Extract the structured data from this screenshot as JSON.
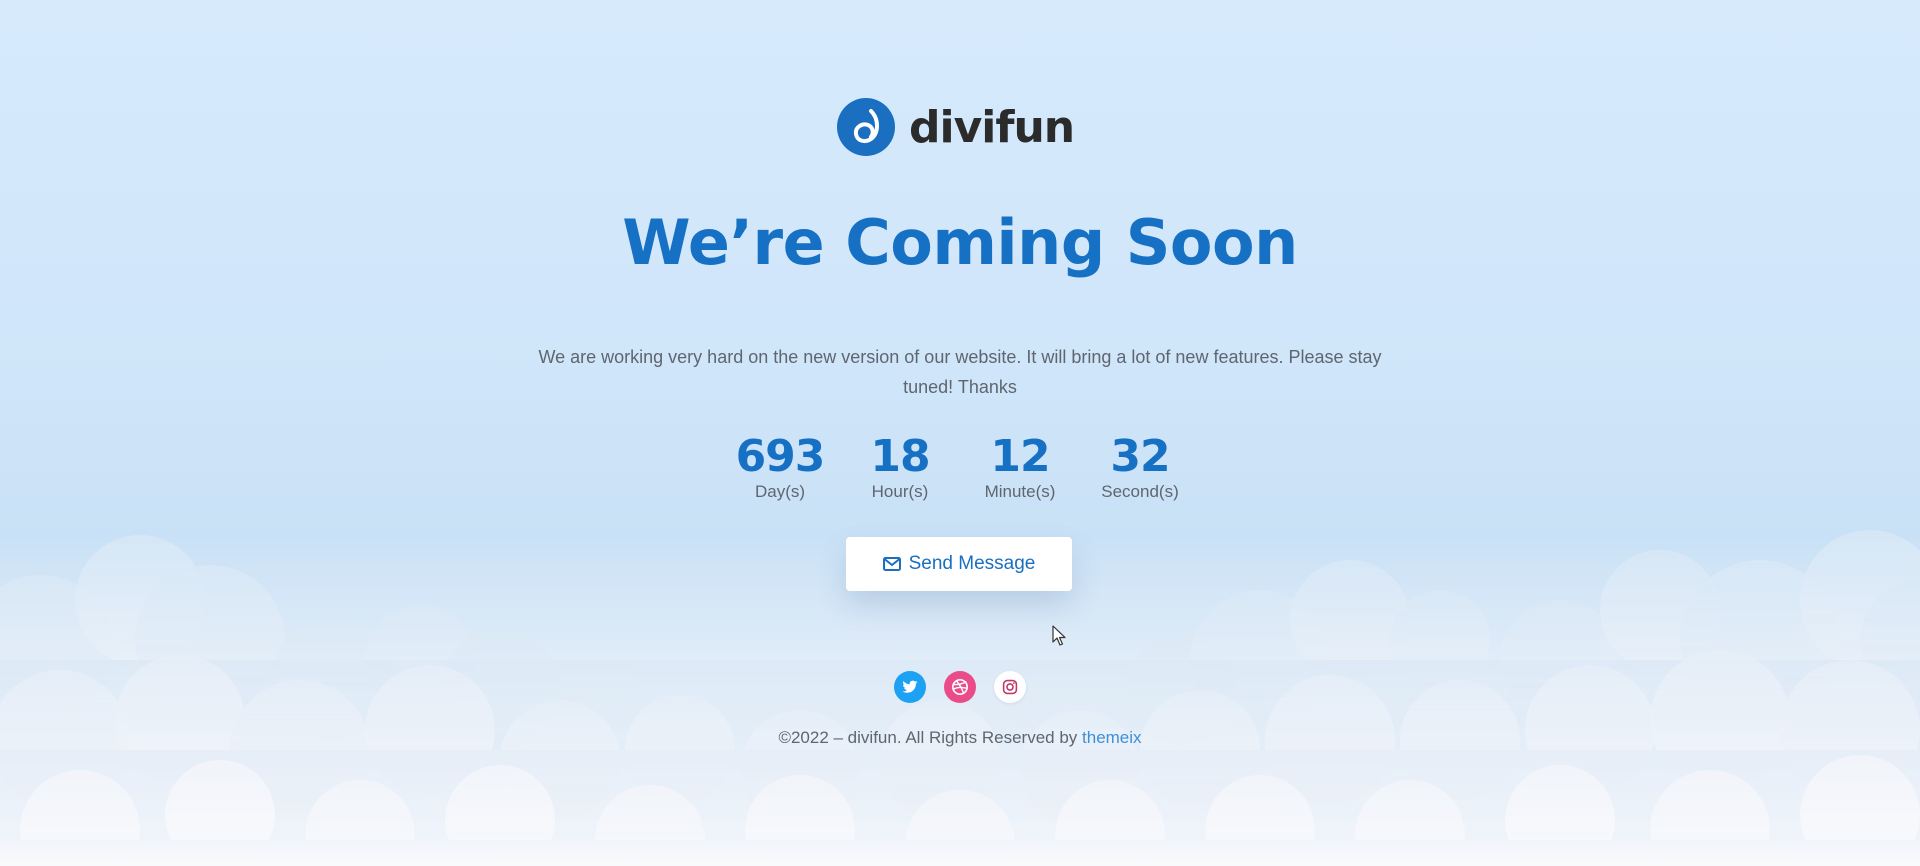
{
  "brand": {
    "name": "divifun",
    "primary_color": "#1670c4"
  },
  "hero": {
    "title": "We’re Coming Soon",
    "description": "We are working very hard on the new version of our website. It will bring a  lot of new features. Please stay tuned! Thanks"
  },
  "countdown": [
    {
      "value": "693",
      "label": "Day(s)"
    },
    {
      "value": "18",
      "label": "Hour(s)"
    },
    {
      "value": "12",
      "label": "Minute(s)"
    },
    {
      "value": "32",
      "label": "Second(s)"
    }
  ],
  "cta": {
    "label": "Send Message",
    "icon": "envelope-icon"
  },
  "socials": [
    {
      "name": "twitter",
      "icon": "twitter-icon",
      "color": "#1da1f2"
    },
    {
      "name": "dribbble",
      "icon": "dribbble-icon",
      "color": "#ea4c89"
    },
    {
      "name": "instagram",
      "icon": "instagram-icon",
      "color": "#ffffff"
    }
  ],
  "footer": {
    "text": "©2022 – divifun. All Rights Reserved by ",
    "link_label": "themeix",
    "link_color": "#3f8fd6"
  }
}
